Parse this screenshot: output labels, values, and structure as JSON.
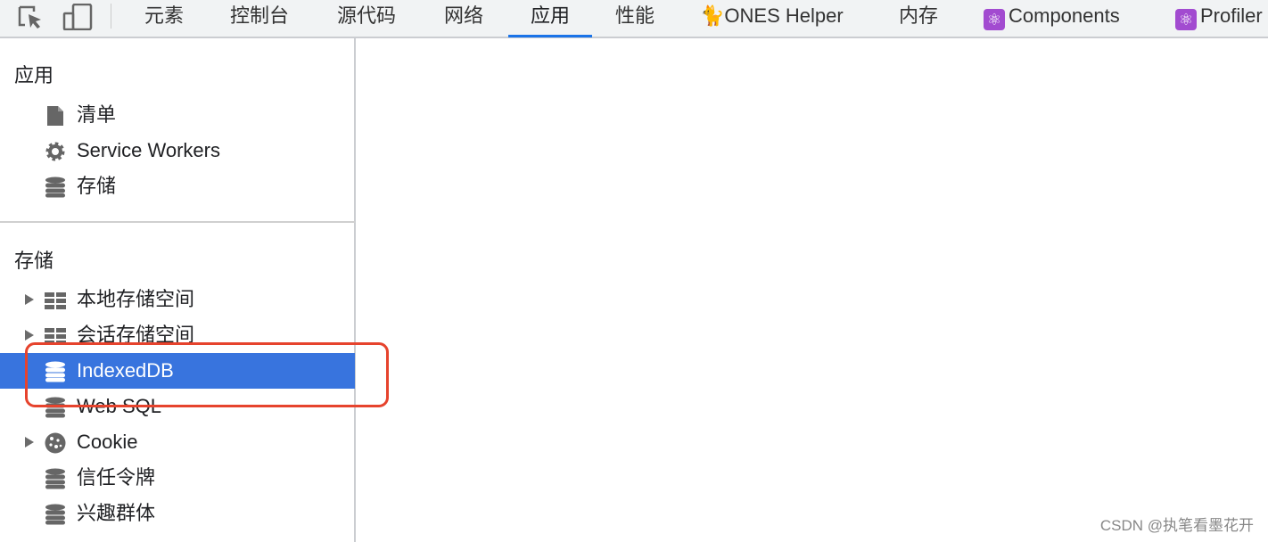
{
  "toolbar": {
    "tabs": [
      "元素",
      "控制台",
      "源代码",
      "网络",
      "应用",
      "性能",
      "ONES Helper",
      "内存",
      "Components",
      "Profiler"
    ],
    "active_tab": "应用"
  },
  "sidebar": {
    "app_section": "应用",
    "app_items": [
      {
        "label": "清单",
        "icon": "file-icon"
      },
      {
        "label": "Service Workers",
        "icon": "gear-icon"
      },
      {
        "label": "存储",
        "icon": "database-icon"
      }
    ],
    "storage_section": "存储",
    "storage_items": [
      {
        "label": "本地存储空间",
        "icon": "grid-icon",
        "expandable": true
      },
      {
        "label": "会话存储空间",
        "icon": "grid-icon",
        "expandable": true
      },
      {
        "label": "IndexedDB",
        "icon": "database-icon",
        "selected": true
      },
      {
        "label": "Web SQL",
        "icon": "database-icon"
      },
      {
        "label": "Cookie",
        "icon": "cookie-icon",
        "expandable": true
      },
      {
        "label": "信任令牌",
        "icon": "database-icon"
      },
      {
        "label": "兴趣群体",
        "icon": "database-icon"
      }
    ]
  },
  "colors": {
    "selected": "#3874de",
    "highlight_box": "#e6432d",
    "active_tab_underline": "#1a73e8"
  },
  "watermark": "CSDN @执笔看墨花开"
}
